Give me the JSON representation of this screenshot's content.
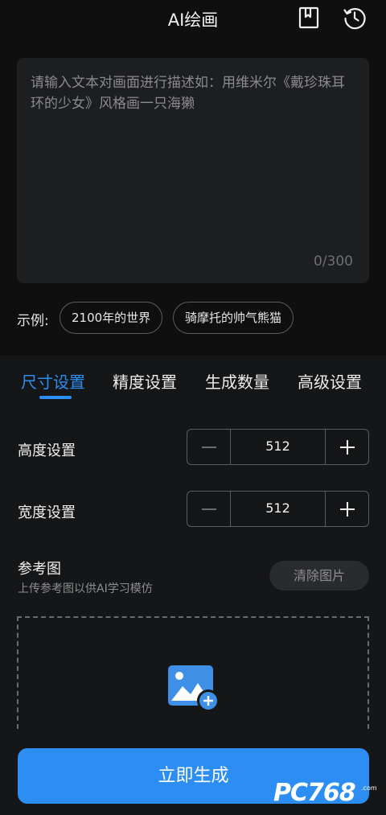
{
  "header": {
    "title": "AI绘画",
    "icons": [
      "bookmark-icon",
      "history-icon"
    ]
  },
  "prompt": {
    "placeholder": "请输入文本对画面进行描述如：用维米尔《戴珍珠耳环的少女》风格画一只海獭",
    "counter": "0/300"
  },
  "examples": {
    "label": "示例:",
    "chips": [
      "2100年的世界",
      "骑摩托的帅气熊猫"
    ]
  },
  "tabs": [
    {
      "label": "尺寸设置",
      "active": true
    },
    {
      "label": "精度设置",
      "active": false
    },
    {
      "label": "生成数量",
      "active": false
    },
    {
      "label": "高级设置",
      "active": false
    }
  ],
  "height": {
    "label": "高度设置",
    "value": "512"
  },
  "width": {
    "label": "宽度设置",
    "value": "512"
  },
  "reference": {
    "title": "参考图",
    "subtitle": "上传参考图以供AI学习模仿",
    "clear_label": "清除图片"
  },
  "generate_label": "立即生成",
  "watermark": {
    "brand": "PC768",
    "suffix": ".com"
  },
  "colors": {
    "accent": "#2c8df2",
    "background": "#0f0f10",
    "panel": "#151617"
  }
}
